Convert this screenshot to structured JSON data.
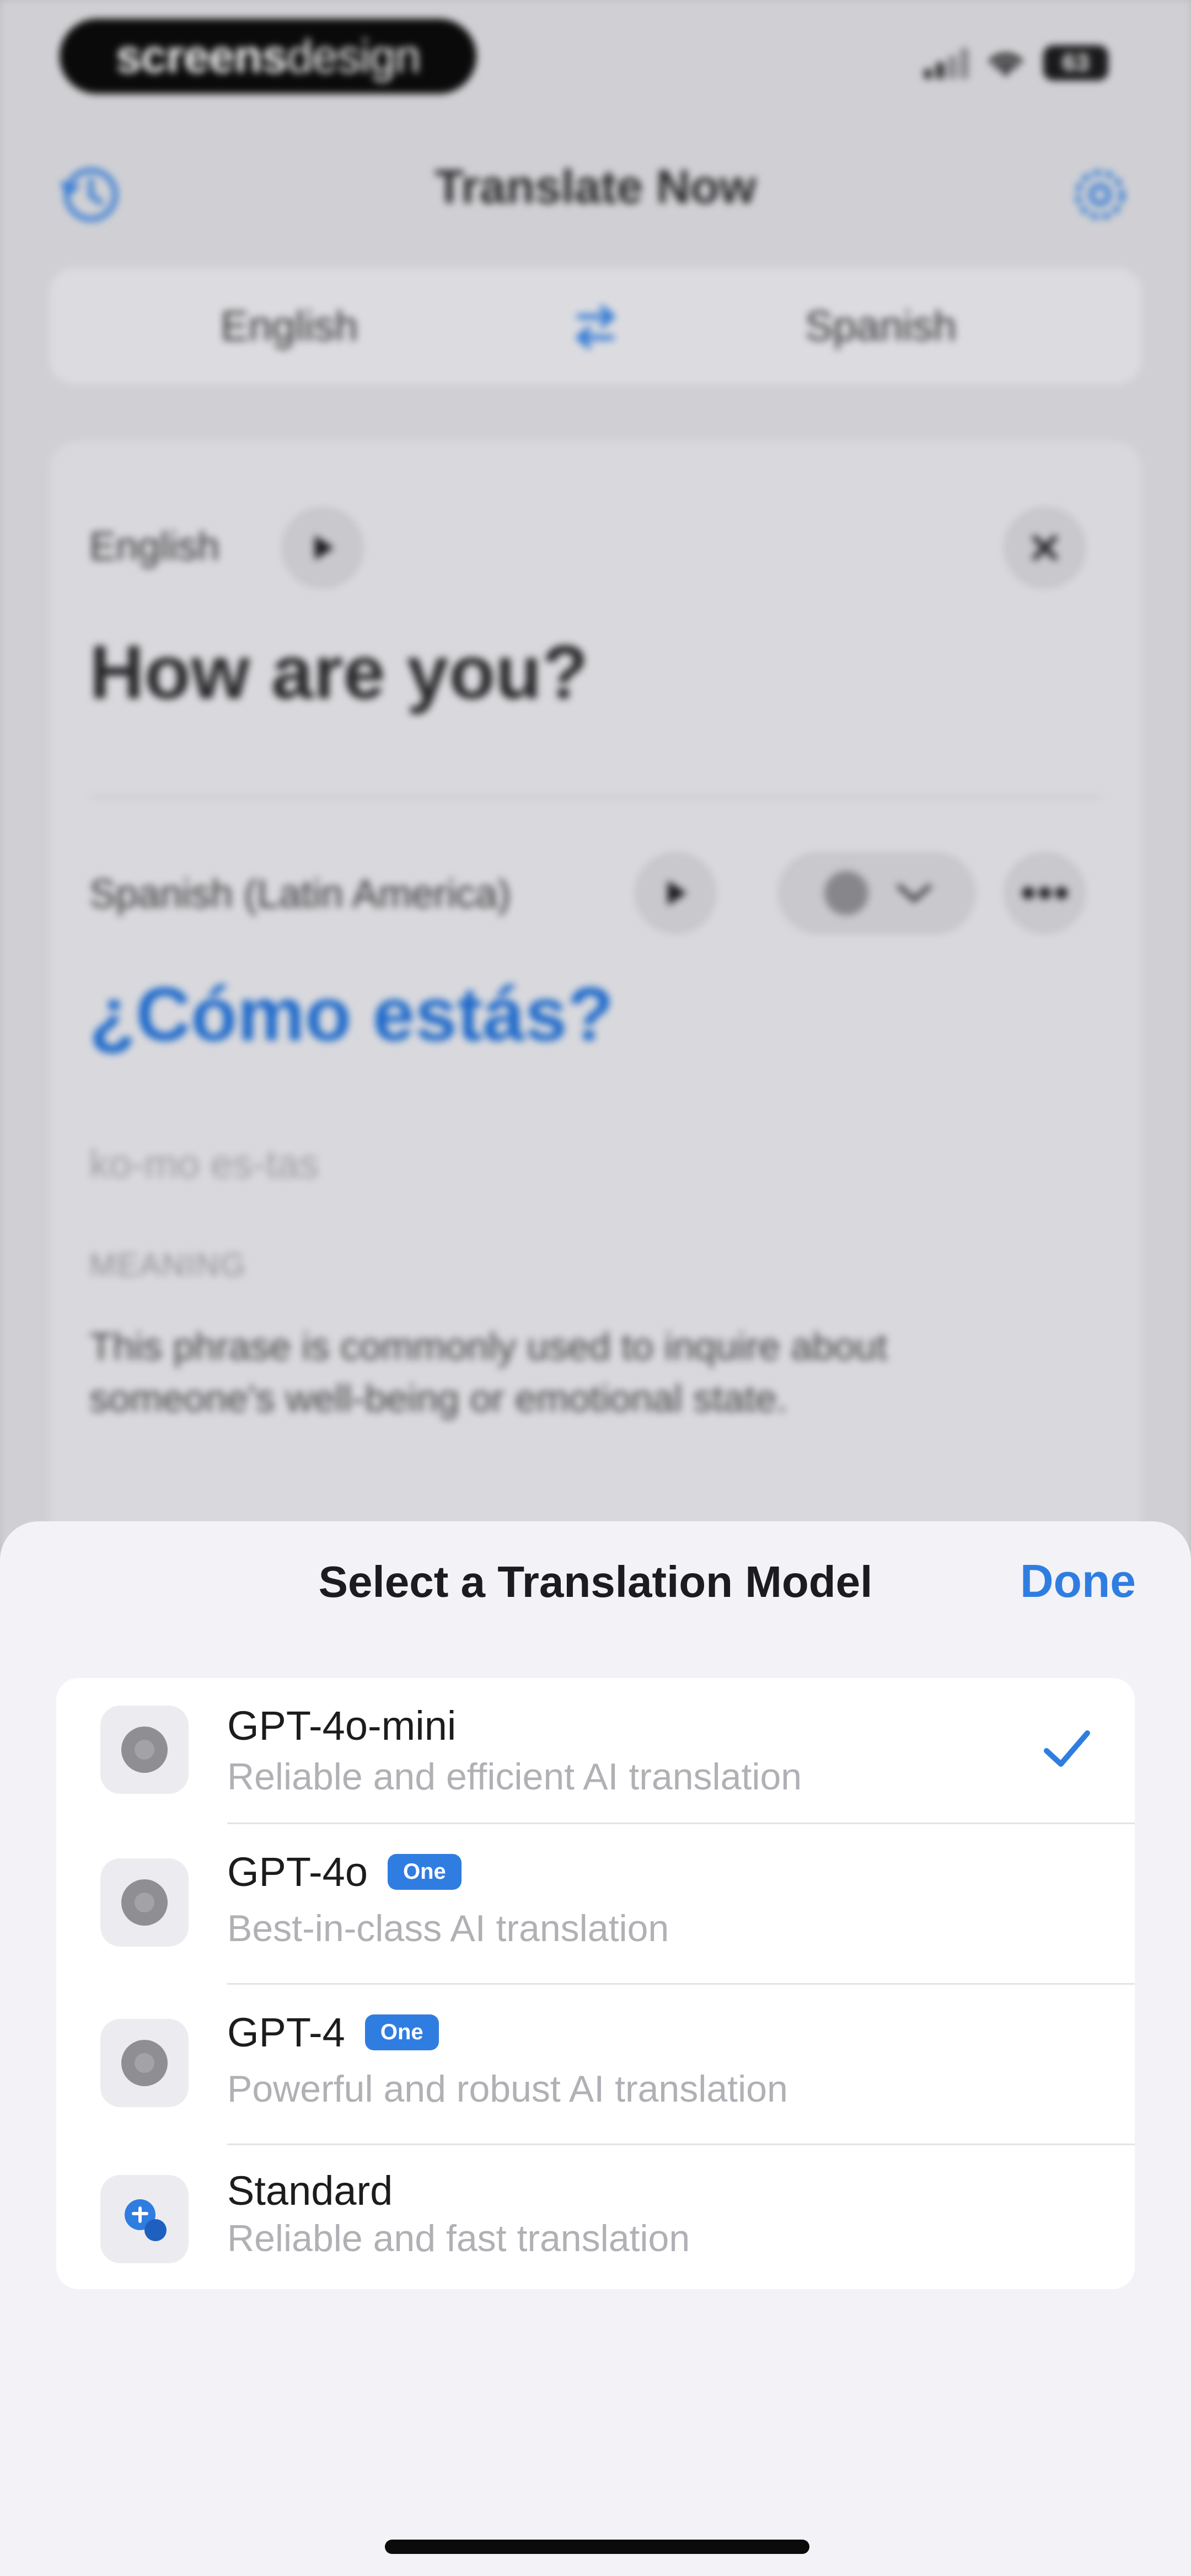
{
  "status_bar": {
    "brand_bold": "screens",
    "brand_light": "design",
    "battery": "63"
  },
  "nav": {
    "title": "Translate Now",
    "history_icon": "clock-history-icon",
    "settings_icon": "gear-icon"
  },
  "language_bar": {
    "source": "English",
    "target": "Spanish",
    "swap_icon": "swap-arrows-icon"
  },
  "card": {
    "source_label": "English",
    "source_text": "How are you?",
    "target_label": "Spanish (Latin America)",
    "target_text": "¿Cómo estás?",
    "phonetic": "ko-mo es-tas",
    "meaning_heading": "MEANING",
    "meaning_text": "This phrase is commonly used to inquire about someone's well-being or emotional state."
  },
  "sheet": {
    "title": "Select a Translation Model",
    "done_label": "Done",
    "models": [
      {
        "name": "GPT-4o-mini",
        "description": "Reliable and efficient AI translation",
        "badge": "",
        "selected": true,
        "icon": "openai-icon"
      },
      {
        "name": "GPT-4o",
        "description": "Best-in-class AI translation",
        "badge": "One",
        "selected": false,
        "icon": "openai-icon"
      },
      {
        "name": "GPT-4",
        "description": "Powerful and robust AI translation",
        "badge": "One",
        "selected": false,
        "icon": "openai-icon"
      },
      {
        "name": "Standard",
        "description": "Reliable and fast translation",
        "badge": "",
        "selected": false,
        "icon": "translate-icon"
      }
    ]
  },
  "colors": {
    "accent": "#2f7de1",
    "sheet_background": "#f2f2f7"
  }
}
